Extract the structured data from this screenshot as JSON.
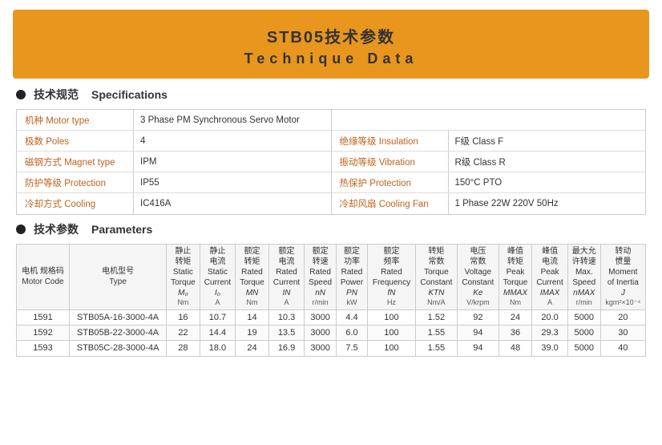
{
  "header": {
    "title_cn": "STB05技术参数",
    "title_en": "Technique Data"
  },
  "specs_section": {
    "label_cn": "技术规范",
    "label_en": "Specifications"
  },
  "params_section": {
    "label_cn": "技术参数",
    "label_en": "Parameters"
  },
  "spec_items_left": [
    {
      "label": "机种 Motor type",
      "value": "3 Phase PM Synchronous Servo Motor"
    },
    {
      "label": "极数 Poles",
      "value": "4"
    },
    {
      "label": "磁钢方式 Magnet type",
      "value": "IPM"
    },
    {
      "label": "防护等级 Protection",
      "value": "IP55"
    },
    {
      "label": "冷却方式 Cooling",
      "value": "IC416A"
    }
  ],
  "spec_items_right": [
    {
      "label": "绝缘等级 Insulation",
      "value": "F级  Class F"
    },
    {
      "label": "振动等级 Vibration",
      "value": "R级  Class R"
    },
    {
      "label": "热保护 Protection",
      "value": "150°C PTO"
    },
    {
      "label": "冷却风扇 Cooling Fan",
      "value": "1 Phase  22W  220V  50Hz"
    }
  ],
  "table": {
    "headers": [
      {
        "cn": "电机\n规格码",
        "en": "Motor\nCode",
        "sym": "",
        "unit": ""
      },
      {
        "cn": "电机型号",
        "en": "Type",
        "sym": "",
        "unit": ""
      },
      {
        "cn": "静止\n转矩",
        "en": "Static\nTorque",
        "sym": "M₀",
        "unit": "Nm"
      },
      {
        "cn": "静止\n电流",
        "en": "Static\nCurrent",
        "sym": "I₀",
        "unit": "A"
      },
      {
        "cn": "额定\n转矩",
        "en": "Rated\nTorque",
        "sym": "MN",
        "unit": "Nm"
      },
      {
        "cn": "额定\n电流",
        "en": "Rated\nCurrent",
        "sym": "IN",
        "unit": "A"
      },
      {
        "cn": "额定\n转速",
        "en": "Rated\nSpeed",
        "sym": "nN",
        "unit": "r/min"
      },
      {
        "cn": "额定\n功率",
        "en": "Rated\nPower",
        "sym": "PN",
        "unit": "kW"
      },
      {
        "cn": "额定\n频率",
        "en": "Rated\nFrequency",
        "sym": "fN",
        "unit": "Hz"
      },
      {
        "cn": "转矩\n常数",
        "en": "Torque\nConstant",
        "sym": "KTN",
        "unit": "Nm/A"
      },
      {
        "cn": "电压\n常数",
        "en": "Voltage\nConstant",
        "sym": "Ke",
        "unit": "V/krpm"
      },
      {
        "cn": "峰值\n转矩",
        "en": "Peak\nTorque",
        "sym": "MMAX",
        "unit": "Nm"
      },
      {
        "cn": "峰值\n电流",
        "en": "Peak\nCurrent",
        "sym": "IMAX",
        "unit": "A"
      },
      {
        "cn": "最大允\n许转速",
        "en": "Max.\nSpeed",
        "sym": "nMAX",
        "unit": "r/min"
      },
      {
        "cn": "转动\n惯量",
        "en": "Moment\nof Inertia",
        "sym": "J",
        "unit": "kgm²×10⁻⁴"
      }
    ],
    "rows": [
      {
        "code": "1591",
        "type": "STB05A-16-3000-4A",
        "m0": "16",
        "i0": "10.7",
        "mn": "14",
        "in": "10.3",
        "n": "3000",
        "p": "4.4",
        "f": "100",
        "kt": "1.52",
        "ke": "92",
        "mmax": "24",
        "imax": "20.0",
        "nmax": "5000",
        "j": "20"
      },
      {
        "code": "1592",
        "type": "STB05B-22-3000-4A",
        "m0": "22",
        "i0": "14.4",
        "mn": "19",
        "in": "13.5",
        "n": "3000",
        "p": "6.0",
        "f": "100",
        "kt": "1.55",
        "ke": "94",
        "mmax": "36",
        "imax": "29.3",
        "nmax": "5000",
        "j": "30"
      },
      {
        "code": "1593",
        "type": "STB05C-28-3000-4A",
        "m0": "28",
        "i0": "18.0",
        "mn": "24",
        "in": "16.9",
        "n": "3000",
        "p": "7.5",
        "f": "100",
        "kt": "1.55",
        "ke": "94",
        "mmax": "48",
        "imax": "39.0",
        "nmax": "5000",
        "j": "40"
      }
    ]
  }
}
